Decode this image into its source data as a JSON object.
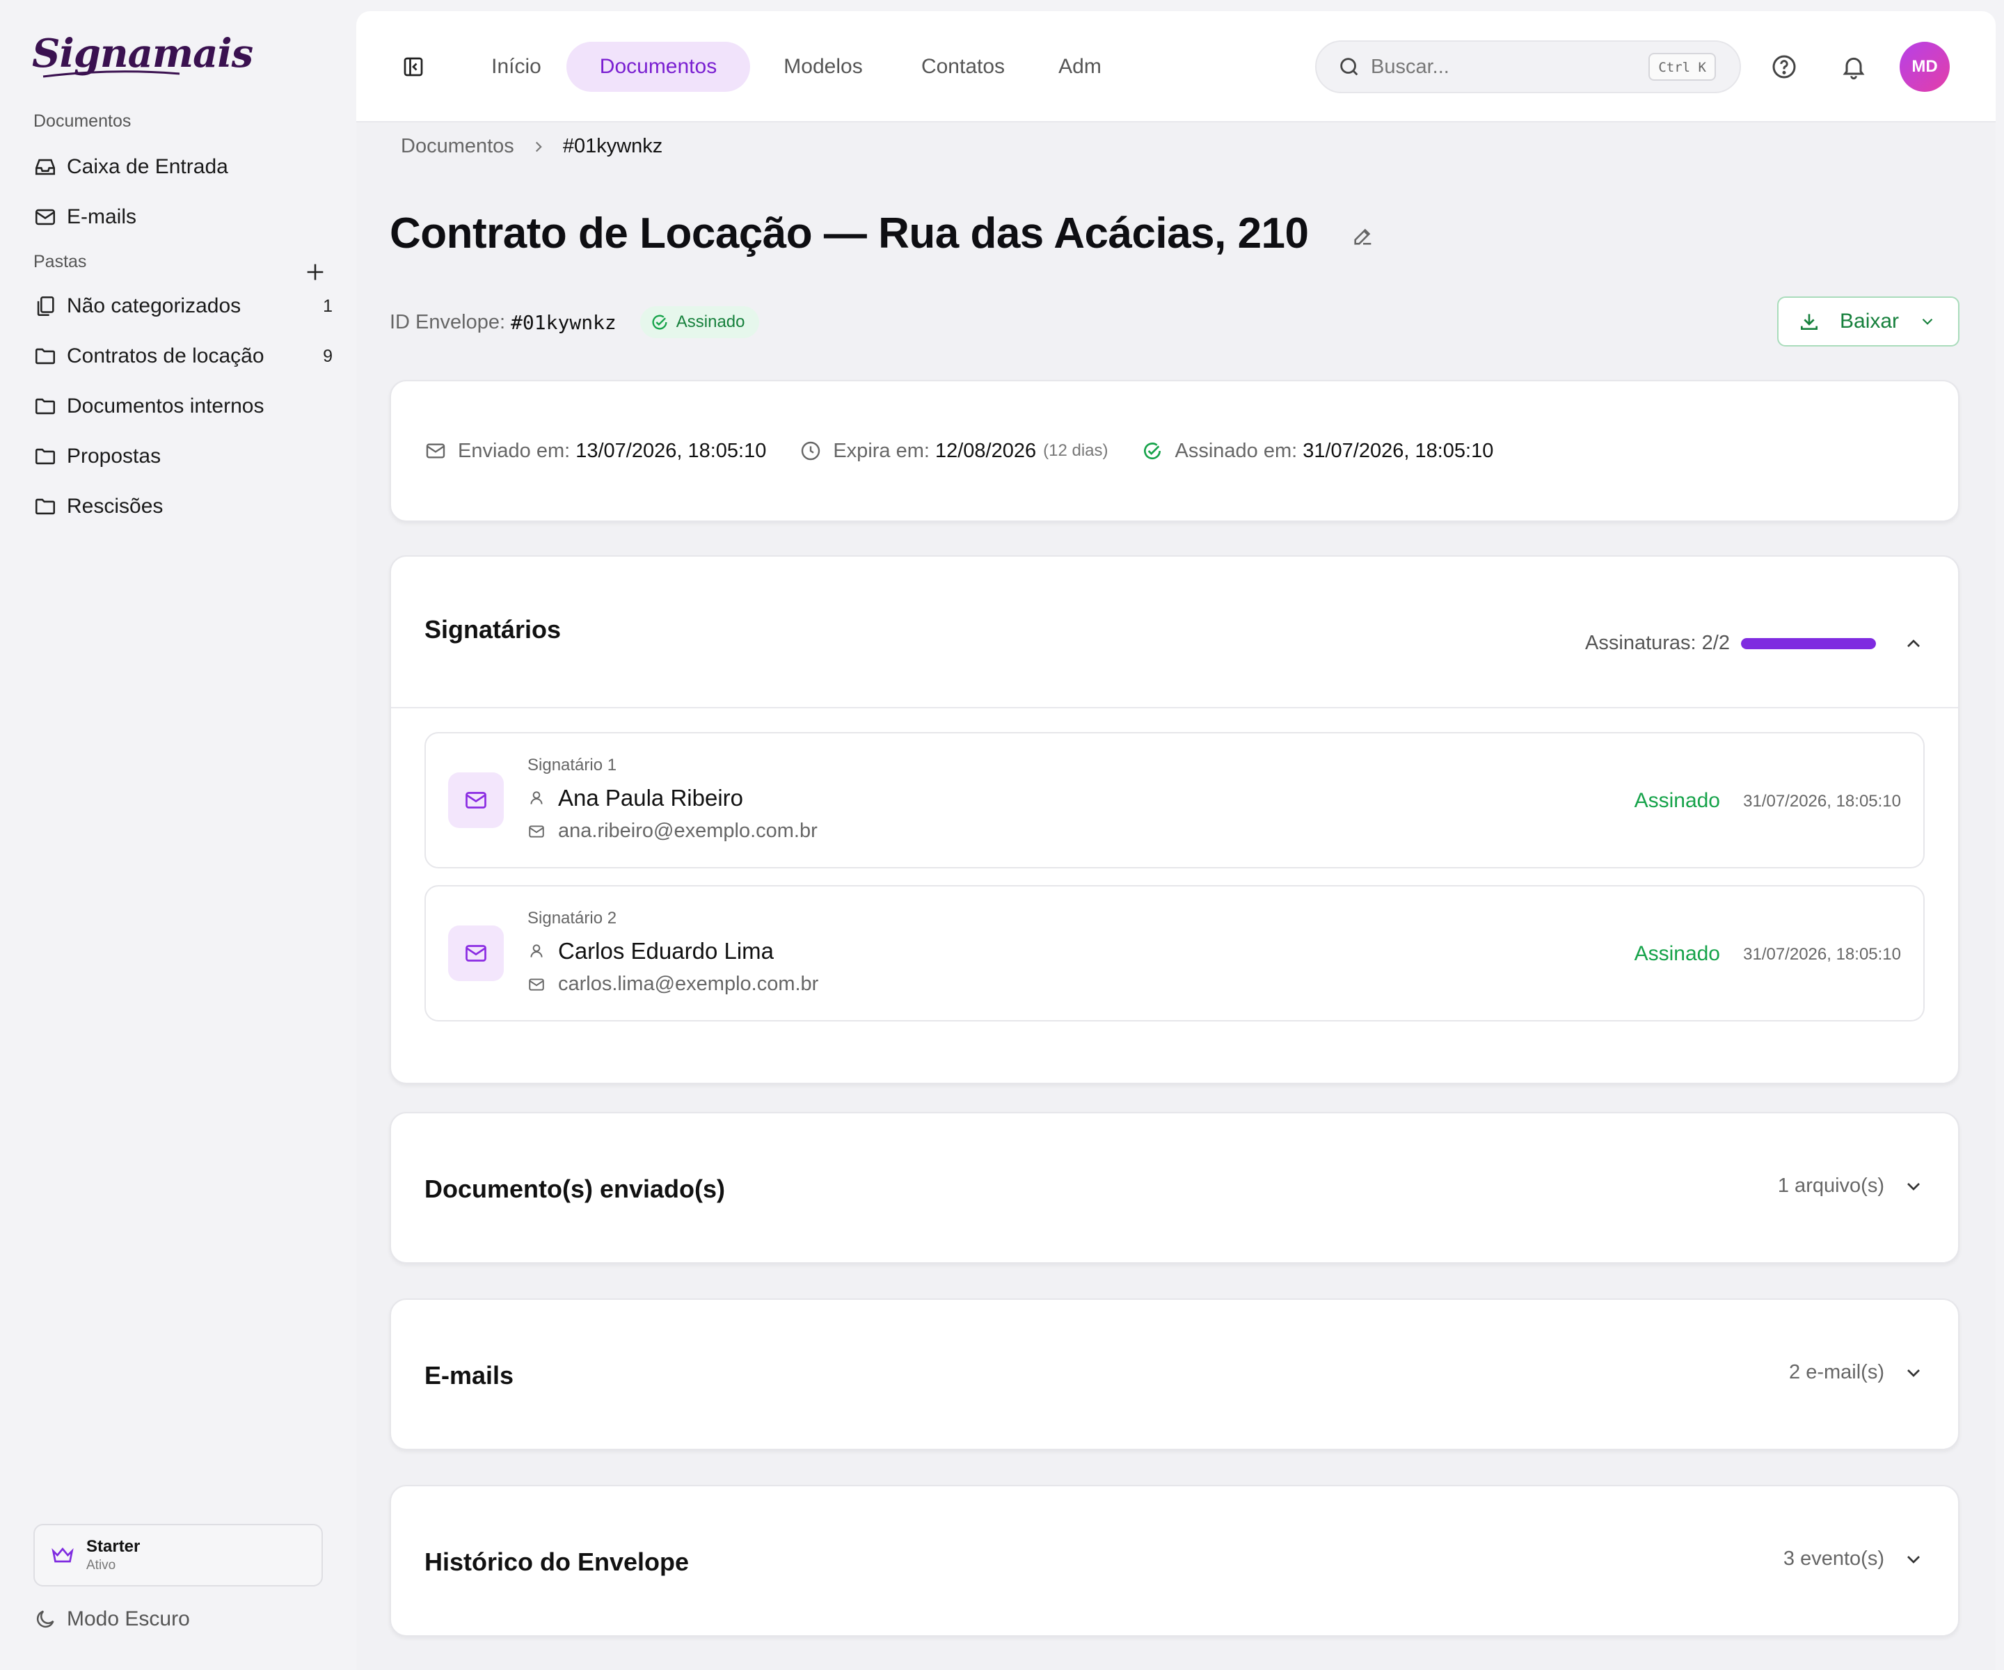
{
  "app": {
    "logo_text": "Signamais"
  },
  "sidebar": {
    "documents_label": "Documentos",
    "documents_items": [
      {
        "label": "Caixa de Entrada",
        "icon": "inbox-icon"
      },
      {
        "label": "E-mails",
        "icon": "mail-icon"
      }
    ],
    "folders_label": "Pastas",
    "folders": [
      {
        "label": "Não categorizados",
        "count": "1",
        "icon": "files-icon"
      },
      {
        "label": "Contratos de locação",
        "count": "9",
        "icon": "folder-icon"
      },
      {
        "label": "Documentos internos",
        "count": "",
        "icon": "folder-icon"
      },
      {
        "label": "Propostas",
        "count": "",
        "icon": "folder-icon"
      },
      {
        "label": "Rescisões",
        "count": "",
        "icon": "folder-icon"
      }
    ],
    "plan": {
      "name": "Starter",
      "status": "Ativo",
      "icon": "crown-icon"
    },
    "dark_mode_label": "Modo Escuro"
  },
  "topbar": {
    "tabs": [
      "Início",
      "Documentos",
      "Modelos",
      "Contatos",
      "Adm"
    ],
    "active_tab": "Documentos",
    "search_placeholder": "Buscar...",
    "search_shortcut": "Ctrl K",
    "avatar_initials": "MD"
  },
  "breadcrumb": {
    "parent": "Documentos",
    "current": "#01kywnkz"
  },
  "document": {
    "title": "Contrato de Locação — Rua das Acácias, 210",
    "envelope_id_label": "ID Envelope:",
    "envelope_id": "#01kywnkz",
    "status_badge": "Assinado",
    "download_label": "Baixar"
  },
  "dates": {
    "sent_label": "Enviado em:",
    "sent_value": "13/07/2026, 18:05:10",
    "expires_label": "Expira em:",
    "expires_value": "12/08/2026",
    "expires_note": "(12 dias)",
    "signed_label": "Assinado em:",
    "signed_value": "31/07/2026, 18:05:10"
  },
  "signatories": {
    "title": "Signatários",
    "progress_label": "Assinaturas: 2/2",
    "progress_fraction": 1.0,
    "items": [
      {
        "label": "Signatário 1",
        "name": "Ana Paula Ribeiro",
        "email": "ana.ribeiro@exemplo.com.br",
        "status": "Assinado",
        "signed_at": "31/07/2026, 18:05:10"
      },
      {
        "label": "Signatário 2",
        "name": "Carlos Eduardo Lima",
        "email": "carlos.lima@exemplo.com.br",
        "status": "Assinado",
        "signed_at": "31/07/2026, 18:05:10"
      }
    ]
  },
  "sections": [
    {
      "title": "Documento(s) enviado(s)",
      "meta": "1 arquivo(s)"
    },
    {
      "title": "E-mails",
      "meta": "2 e-mail(s)"
    },
    {
      "title": "Histórico do Envelope",
      "meta": "3 evento(s)"
    }
  ],
  "colors": {
    "accent": "#7f2be0",
    "success": "#16a34a",
    "active_tab_bg": "#f1e3fb"
  }
}
